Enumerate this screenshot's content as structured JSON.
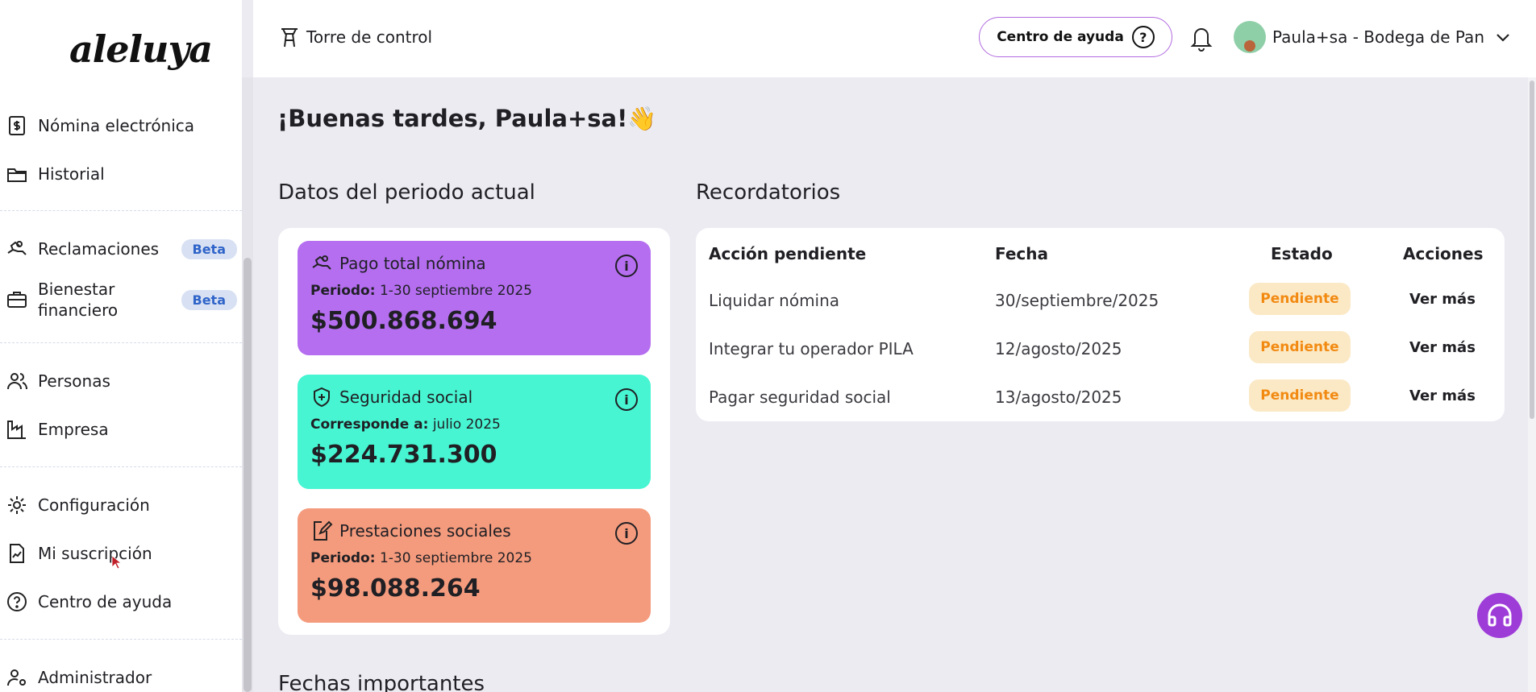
{
  "brand": {
    "logo": "aleluya"
  },
  "sidebar": {
    "items": [
      {
        "label": "Nómina electrónica",
        "icon": "payroll-document-icon"
      },
      {
        "label": "Historial",
        "icon": "folder-icon"
      },
      {
        "label": "Reclamaciones",
        "icon": "claims-hand-icon",
        "badge": "Beta"
      },
      {
        "label": "Bienestar financiero",
        "icon": "briefcase-icon",
        "badge": "Beta"
      },
      {
        "label": "Personas",
        "icon": "people-icon"
      },
      {
        "label": "Empresa",
        "icon": "factory-icon"
      },
      {
        "label": "Configuración",
        "icon": "gear-icon"
      },
      {
        "label": "Mi suscripción",
        "icon": "subscription-icon"
      },
      {
        "label": "Centro de ayuda",
        "icon": "help-circle-icon"
      },
      {
        "label": "Administrador",
        "icon": "admin-user-icon"
      }
    ]
  },
  "topbar": {
    "control_tower": "Torre de control",
    "help_button": "Centro de ayuda",
    "user_name": "Paula+sa - Bodega de Pan"
  },
  "main": {
    "greeting": "¡Buenas tardes, Paula+sa!👋",
    "period_title": "Datos del periodo actual",
    "reminders_title": "Recordatorios",
    "important_dates_title": "Fechas importantes"
  },
  "cards": [
    {
      "title": "Pago total nómina",
      "sub_label": "Periodo:",
      "sub_value": "1-30 septiembre 2025",
      "amount": "$500.868.694",
      "color": "#b56ef0"
    },
    {
      "title": "Seguridad social",
      "sub_label": "Corresponde a:",
      "sub_value": "julio 2025",
      "amount": "$224.731.300",
      "color": "#47f5d2"
    },
    {
      "title": "Prestaciones sociales",
      "sub_label": "Periodo:",
      "sub_value": "1-30 septiembre 2025",
      "amount": "$98.088.264",
      "color": "#f59b7d"
    }
  ],
  "reminders": {
    "headers": {
      "action": "Acción pendiente",
      "date": "Fecha",
      "status": "Estado",
      "actions": "Acciones"
    },
    "rows": [
      {
        "action": "Liquidar nómina",
        "date": "30/septiembre/2025",
        "status": "Pendiente",
        "link": "Ver más"
      },
      {
        "action": "Integrar tu operador PILA",
        "date": "12/agosto/2025",
        "status": "Pendiente",
        "link": "Ver más"
      },
      {
        "action": "Pagar seguridad social",
        "date": "13/agosto/2025",
        "status": "Pendiente",
        "link": "Ver más"
      }
    ]
  },
  "colors": {
    "accent": "#b26be0",
    "status_pending_bg": "#fbe9c6",
    "status_pending_text": "#f28a12",
    "support": "#9e3cd8"
  }
}
